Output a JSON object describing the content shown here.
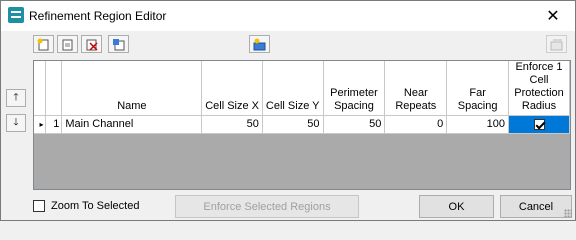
{
  "window": {
    "title": "Refinement Region Editor",
    "close_glyph": "✕"
  },
  "toolbar": {
    "icons": [
      "new-region-icon",
      "copy-region-icon",
      "delete-region-icon",
      "import-icon",
      "edit-region-icon",
      "disabled-tool-icon"
    ]
  },
  "side_buttons": {
    "up_glyph": "🡑",
    "down_glyph": "🡓"
  },
  "grid": {
    "columns": [
      "Name",
      "Cell Size X",
      "Cell Size Y",
      "Perimeter Spacing",
      "Near Repeats",
      "Far Spacing",
      "Enforce 1 Cell Protection Radius"
    ],
    "rows": [
      {
        "marker": "▸",
        "index": "1",
        "name": "Main Channel",
        "cell_size_x": "50",
        "cell_size_y": "50",
        "perimeter_spacing": "50",
        "near_repeats": "0",
        "far_spacing": "100",
        "enforce_radius": true
      }
    ],
    "selection_color": "#0078d7"
  },
  "footer": {
    "zoom_label": "Zoom To Selected",
    "zoom_checked": false,
    "enforce_button": "Enforce Selected Regions",
    "ok_button": "OK",
    "cancel_button": "Cancel"
  }
}
